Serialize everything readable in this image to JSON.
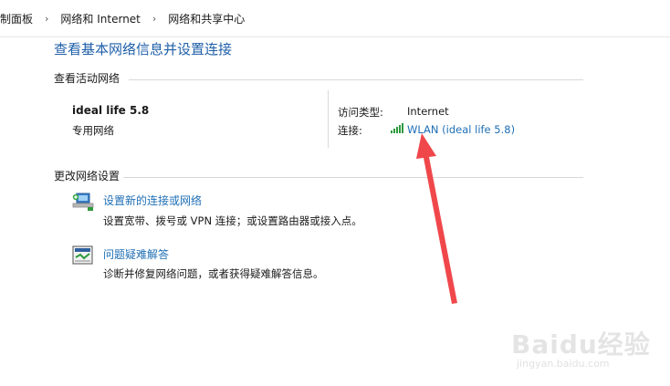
{
  "breadcrumb": {
    "items": [
      "制面板",
      "网络和 Internet",
      "网络和共享中心"
    ]
  },
  "page_title": "查看基本网络信息并设置连接",
  "active_networks": {
    "header": "查看活动网络",
    "network_name": "ideal life 5.8",
    "network_type": "专用网络",
    "access_type_label": "访问类型:",
    "access_type_value": "Internet",
    "connection_label": "连接:",
    "connection_value": "WLAN (ideal life 5.8)"
  },
  "change_settings": {
    "header": "更改网络设置",
    "tasks": [
      {
        "link": "设置新的连接或网络",
        "desc": "设置宽带、拨号或 VPN 连接；或设置路由器或接入点。",
        "icon": "network-setup-icon"
      },
      {
        "link": "问题疑难解答",
        "desc": "诊断并修复网络问题，或者获得疑难解答信息。",
        "icon": "troubleshoot-icon"
      }
    ]
  },
  "watermark": {
    "text": "Baidu经验",
    "url": "jingyan.baidu.com"
  },
  "colors": {
    "link": "#1f6fb5",
    "title": "#1f5fa8",
    "signal": "#2e9a3e",
    "arrow": "#f0474b"
  }
}
